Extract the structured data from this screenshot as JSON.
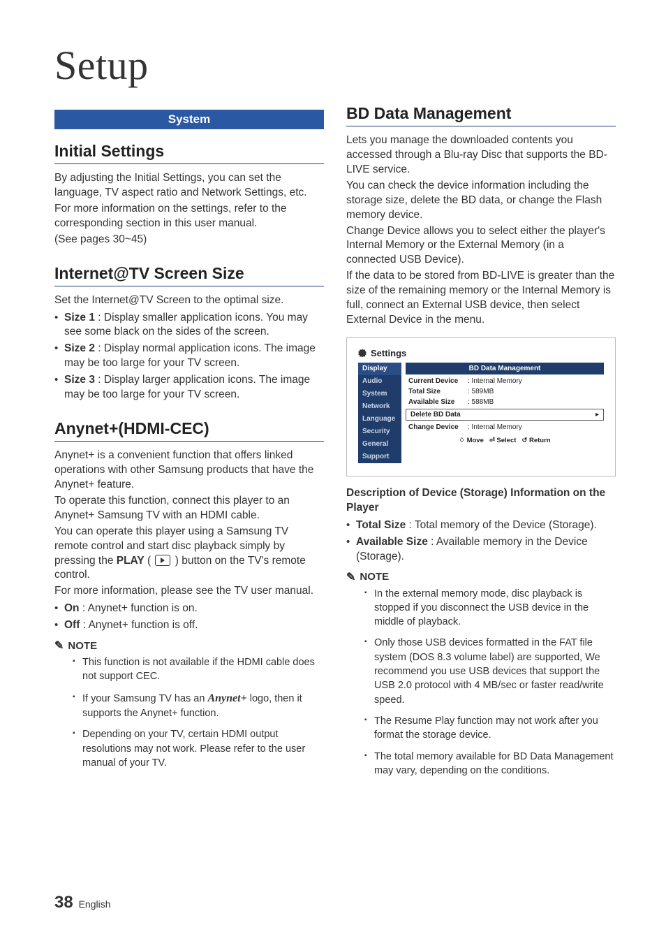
{
  "page_title": "Setup",
  "band": "System",
  "col1": {
    "initial": {
      "h": "Initial Settings",
      "p1": "By adjusting the Initial Settings, you can set the language, TV aspect ratio and Network Settings, etc.",
      "p2": "For more information on the settings, refer to the corresponding section in this user manual.",
      "p3": "(See pages 30~45)"
    },
    "ittv": {
      "h": "Internet@TV Screen Size",
      "p": "Set the Internet@TV Screen to the optimal size.",
      "b1b": "Size 1",
      "b1": " : Display smaller application icons. You may see some black on the sides of the screen.",
      "b2b": "Size 2",
      "b2": " : Display normal application icons. The image may be too large for your TV screen.",
      "b3b": "Size 3",
      "b3": " : Display larger application icons. The image may be too large for your TV screen."
    },
    "anynet": {
      "h": "Anynet+(HDMI-CEC)",
      "p1": "Anynet+ is a convenient function that offers linked operations with other Samsung products that have the Anynet+ feature.",
      "p2": "To operate this function, connect this player to an Anynet+ Samsung TV with an HDMI cable.",
      "p3a": "You can operate this player using a Samsung TV remote control and start disc playback simply by pressing the ",
      "p3play": "PLAY",
      "p3b": " ) button on the TV's remote control.",
      "p4": "For more information, please see the TV user manual.",
      "onb": "On",
      "on": " : Anynet+ function is on.",
      "offb": "Off",
      "off": " : Anynet+ function is off.",
      "note": "NOTE",
      "n1": "This function is not available if the HDMI cable does not support CEC.",
      "n2a": "If your Samsung TV has an ",
      "n2logo": "Anynet+",
      "n2b": " logo, then it supports the Anynet+ function.",
      "n3": "Depending on your TV, certain HDMI output resolutions may not work. Please refer to the user manual of your TV."
    }
  },
  "col2": {
    "bd": {
      "h": "BD Data Management",
      "p1": "Lets you manage the downloaded contents you accessed through a Blu-ray Disc that supports the BD-LIVE service.",
      "p2": "You can check the device information including the storage size, delete the BD data, or change the Flash memory device.",
      "p3": "Change Device allows you to select either the player's Internal Memory or the External Memory (in a connected USB Device).",
      "p4": "If the data to be stored from BD-LIVE is greater than the size of the remaining memory or the Internal Memory is full, connect an External USB device, then select External Device in the menu.",
      "descHd": "Description of Device (Storage) Information on the Player",
      "tsb": "Total Size",
      "ts": " : Total memory of the Device (Storage).",
      "asb": "Available Size",
      "as": " : Available memory in the Device (Storage).",
      "note": "NOTE",
      "n1": "In the external memory mode, disc playback is stopped if you disconnect the USB device in the middle of playback.",
      "n2": "Only those USB devices formatted in the FAT file system (DOS 8.3 volume label) are supported, We recommend you use USB devices that support the USB 2.0 protocol with 4 MB/sec or faster read/write speed.",
      "n3": "The Resume Play function may not work after you format the storage device.",
      "n4": "The total memory available for BD Data Management may vary, depending on the conditions."
    }
  },
  "settings": {
    "title": "Settings",
    "side": [
      "Display",
      "Audio",
      "System",
      "Network",
      "Language",
      "Security",
      "General",
      "Support"
    ],
    "main_hd": "BD Data Management",
    "rows": [
      {
        "k": "Current Device",
        "v": ": Internal Memory"
      },
      {
        "k": "Total Size",
        "v": ": 589MB"
      },
      {
        "k": "Available Size",
        "v": ": 588MB"
      }
    ],
    "del": "Delete BD Data",
    "chg_k": "Change Device",
    "chg_v": ": Internal Memory",
    "foot_move": "Move",
    "foot_select": "Select",
    "foot_return": "Return"
  },
  "footer": {
    "pn": "38",
    "lang": "English"
  }
}
